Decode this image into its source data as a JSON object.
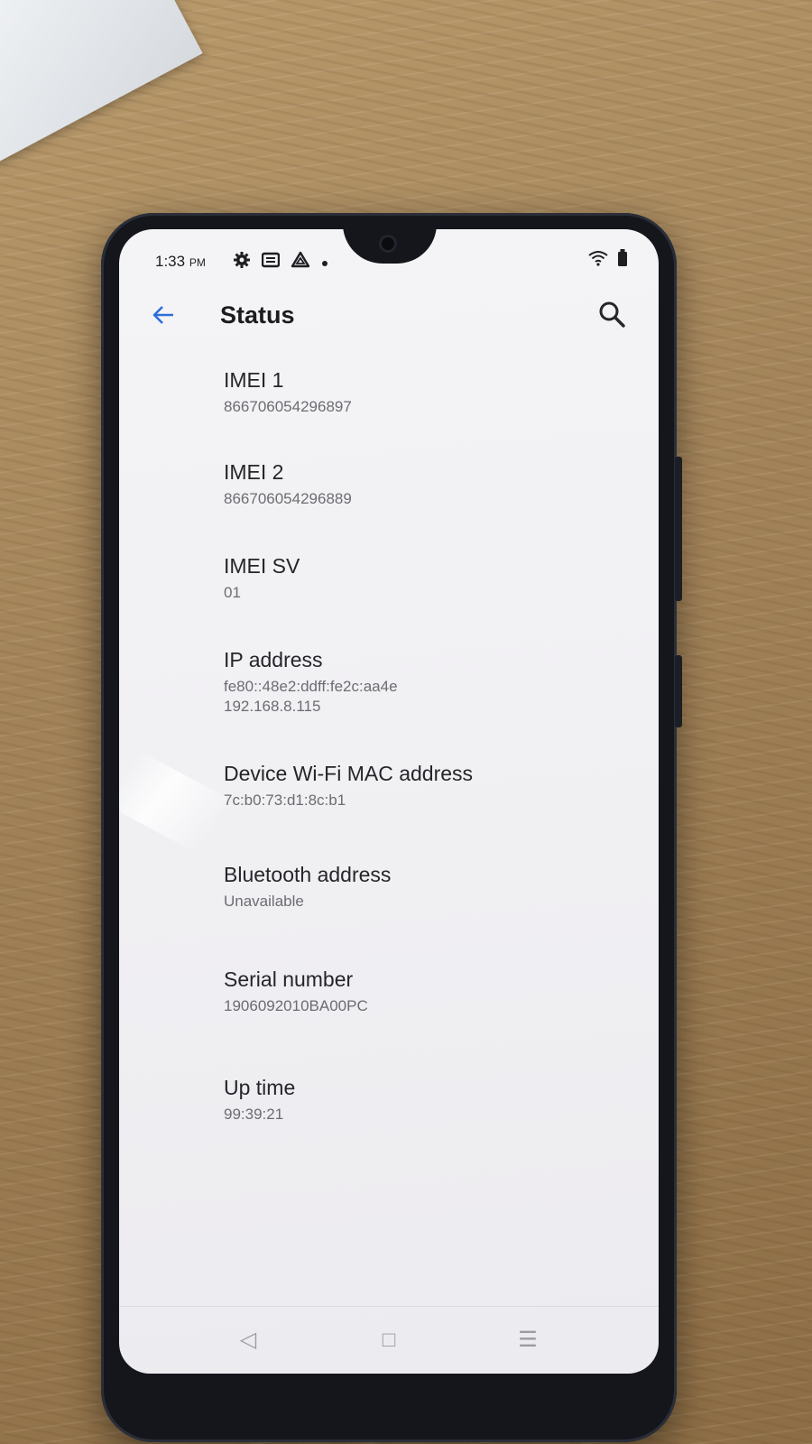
{
  "status_bar": {
    "time": "1:33",
    "ampm": "PM",
    "left_icons": [
      "gear-icon",
      "news-icon",
      "drive-icon",
      "dot-icon"
    ],
    "right_icons": [
      "wifi-icon",
      "battery-icon"
    ]
  },
  "app_bar": {
    "title": "Status",
    "back_icon": "arrow-back-icon",
    "search_icon": "search-icon",
    "accent_color": "#2f6fdc"
  },
  "items": [
    {
      "label": "IMEI 1",
      "values": [
        "866706054296897"
      ]
    },
    {
      "label": "IMEI 2",
      "values": [
        "866706054296889"
      ]
    },
    {
      "label": "IMEI SV",
      "values": [
        "01"
      ]
    },
    {
      "label": "IP address",
      "values": [
        "fe80::48e2:ddff:fe2c:aa4e",
        "192.168.8.115"
      ]
    },
    {
      "label": "Device Wi-Fi MAC address",
      "values": [
        "7c:b0:73:d1:8c:b1"
      ]
    },
    {
      "label": "Bluetooth address",
      "values": [
        "Unavailable"
      ]
    },
    {
      "label": "Serial number",
      "values": [
        "1906092010BA00PC"
      ]
    },
    {
      "label": "Up time",
      "values": [
        "99:39:21"
      ]
    }
  ],
  "nav_bar": {
    "back": "◁",
    "home": "□",
    "menu": "☰"
  }
}
